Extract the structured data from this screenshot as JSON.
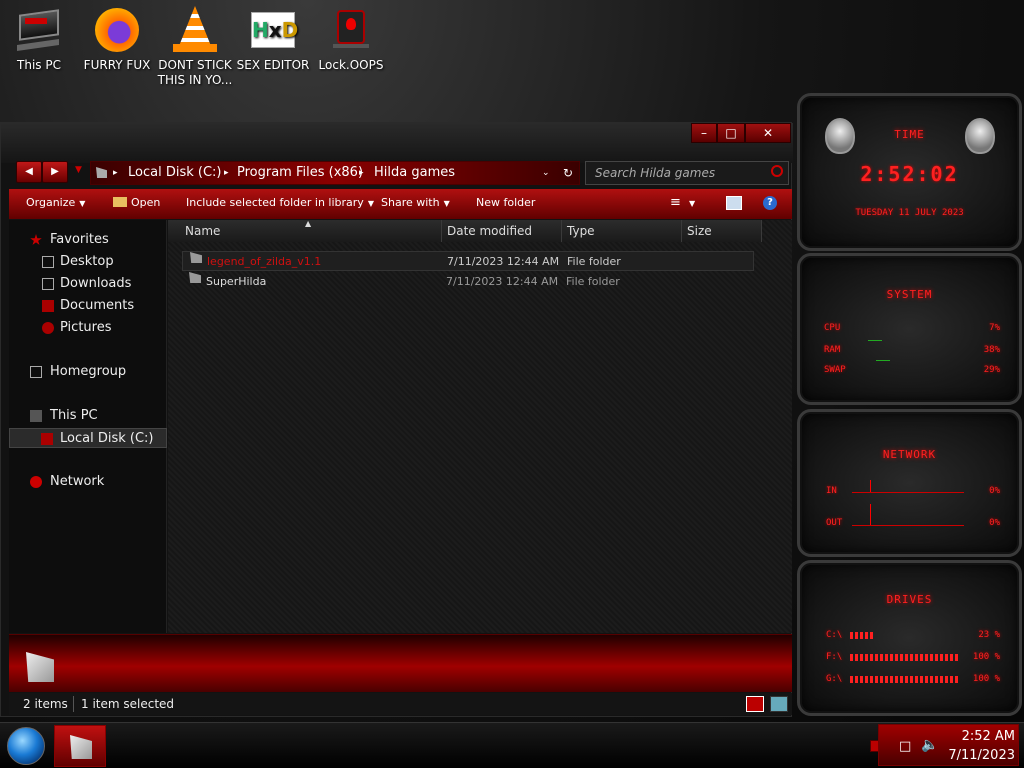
{
  "desktop": {
    "icons": [
      {
        "label": "This PC"
      },
      {
        "label": "FURRY FUX"
      },
      {
        "label": "DONT STICK\nTHIS IN YO..."
      },
      {
        "label": "SEX EDITOR"
      },
      {
        "label": "Lock.OOPS"
      }
    ]
  },
  "explorer": {
    "address": {
      "segments": [
        "Local Disk (C:)",
        "Program Files (x86)",
        "Hilda games"
      ]
    },
    "search_placeholder": "Search Hilda games",
    "toolbar": {
      "organize": "Organize",
      "open": "Open",
      "include": "Include selected folder in library",
      "share": "Share with",
      "new_folder": "New folder"
    },
    "nav": {
      "favorites": "Favorites",
      "desktop": "Desktop",
      "downloads": "Downloads",
      "documents": "Documents",
      "pictures": "Pictures",
      "homegroup": "Homegroup",
      "this_pc": "This PC",
      "local_disk": "Local Disk (C:)",
      "network": "Network"
    },
    "columns": {
      "name": "Name",
      "date": "Date modified",
      "type": "Type",
      "size": "Size"
    },
    "files": [
      {
        "name": "legend_of_zilda_v1.1",
        "date": "7/11/2023 12:44 AM",
        "type": "File folder",
        "selected": true
      },
      {
        "name": "SuperHilda",
        "date": "7/11/2023 12:44 AM",
        "type": "File folder",
        "selected": false
      }
    ],
    "status": {
      "count": "2 items",
      "selected": "1 item selected"
    }
  },
  "gadgets": {
    "time": {
      "title": "TIME",
      "clock": "2:52:02",
      "date": "TUESDAY 11 JULY 2023"
    },
    "system": {
      "title": "SYSTEM",
      "cpu_label": "CPU",
      "cpu_value": "7%",
      "ram_label": "RAM",
      "ram_value": "38%",
      "swap_label": "SWAP",
      "swap_value": "29%"
    },
    "network": {
      "title": "NETWORK",
      "in_label": "IN",
      "in_value": "0%",
      "out_label": "OUT",
      "out_value": "0%"
    },
    "drives": {
      "title": "DRIVES",
      "c_label": "C:\\",
      "c_value": "23 %",
      "f_label": "F:\\",
      "f_value": "100 %",
      "g_label": "G:\\",
      "g_value": "100 %"
    }
  },
  "taskbar": {
    "time": "2:52 AM",
    "date": "7/11/2023"
  },
  "colors": {
    "accent": "#b01010",
    "highlight": "#ff2020"
  }
}
